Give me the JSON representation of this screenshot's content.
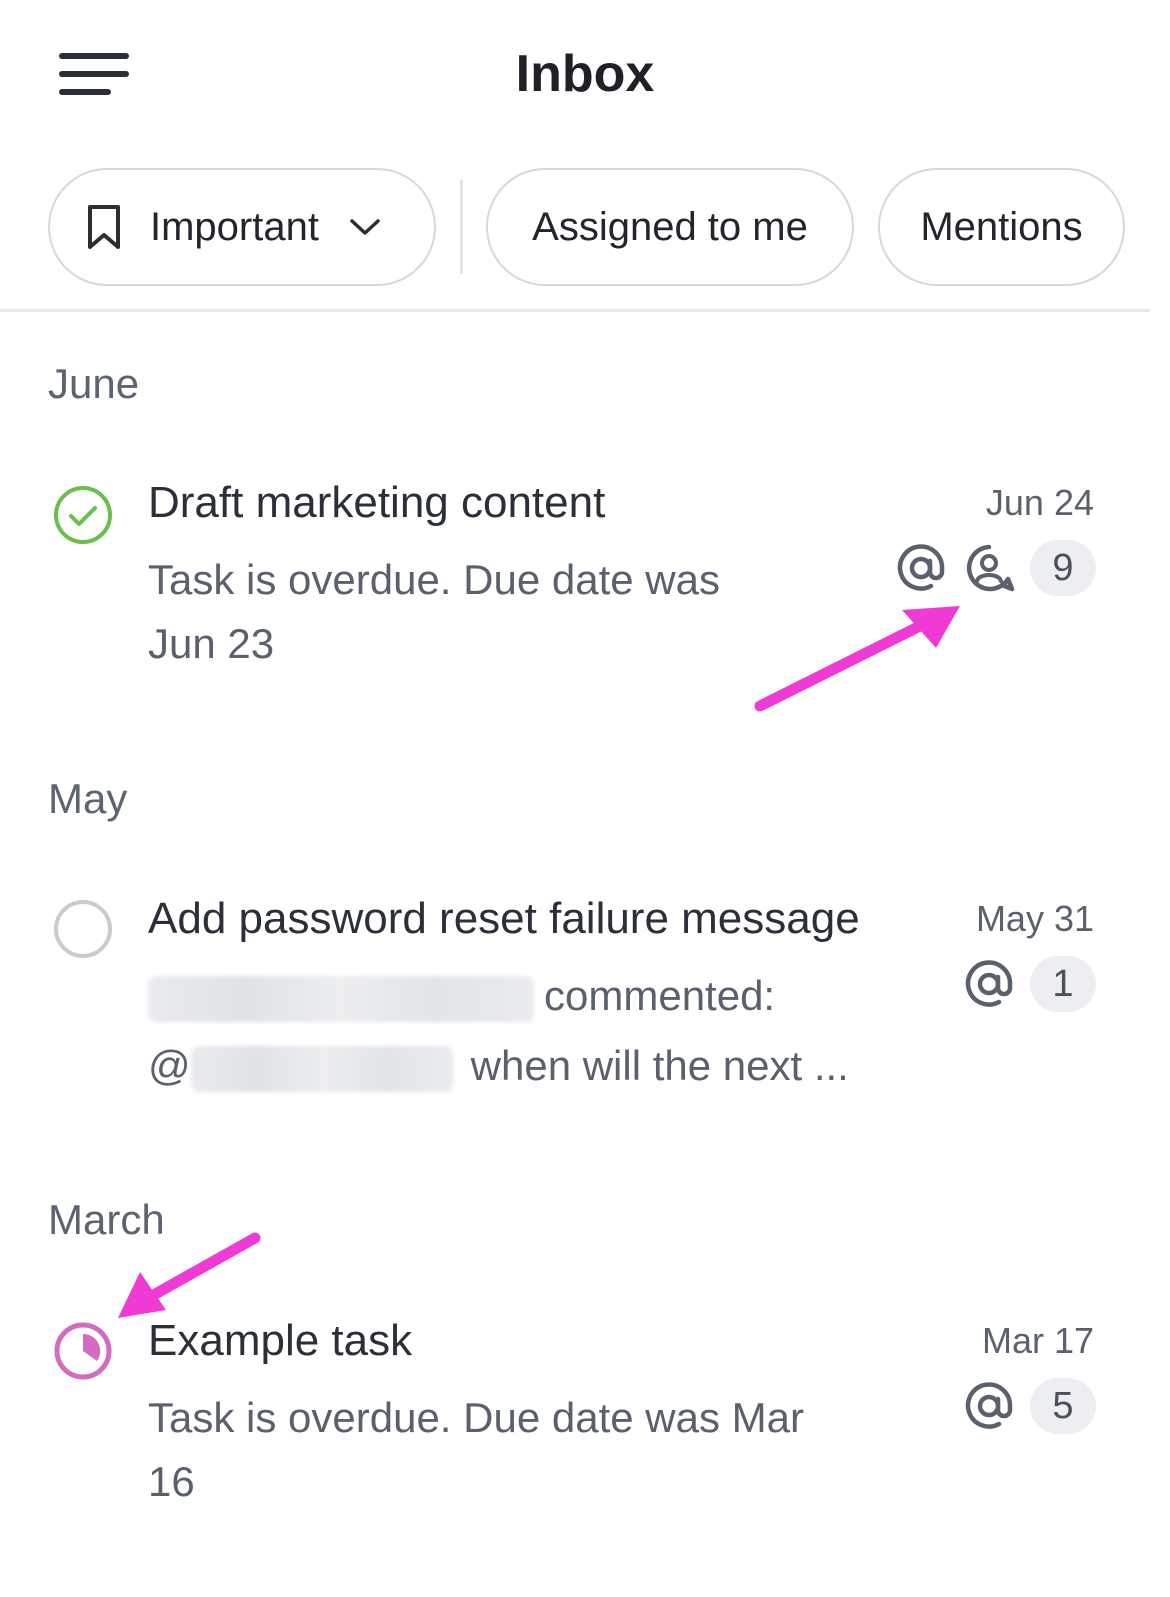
{
  "header": {
    "title": "Inbox",
    "menu_icon": "hamburger-menu-icon"
  },
  "filters": {
    "important": {
      "label": "Important",
      "icon": "bookmark-icon",
      "dropdown_icon": "chevron-down-icon"
    },
    "assigned": {
      "label": "Assigned to me"
    },
    "mentions": {
      "label": "Mentions"
    }
  },
  "sections": [
    {
      "label": "June",
      "items": [
        {
          "status": "completed",
          "status_icon": "check-circle-icon",
          "status_color": "#6abf4b",
          "title": "Draft marketing content",
          "subtitle_line1": "Task is overdue. Due date was",
          "subtitle_line2": "Jun 23",
          "date": "Jun 24",
          "icons": [
            "at-mention-icon",
            "assignee-icon"
          ],
          "count": "9"
        }
      ]
    },
    {
      "label": "May",
      "items": [
        {
          "status": "incomplete",
          "status_icon": "empty-circle-icon",
          "status_color": "#c9cbcf",
          "title": "Add password reset failure message",
          "subtitle_line1": "commented:",
          "subtitle_line2_prefix": "@",
          "subtitle_line2": "when will the next ...",
          "date": "May 31",
          "icons": [
            "at-mention-icon"
          ],
          "count": "1"
        }
      ]
    },
    {
      "label": "March",
      "items": [
        {
          "status": "in-progress",
          "status_icon": "progress-circle-icon",
          "status_color": "#d36bc0",
          "title": "Example task",
          "subtitle_line1": "Task is overdue. Due date was Mar",
          "subtitle_line2": "16",
          "date": "Mar 17",
          "icons": [
            "at-mention-icon"
          ],
          "count": "5"
        }
      ]
    }
  ],
  "colors": {
    "annotation_arrow": "#f03ad6",
    "chip_border": "#d6d8dc",
    "muted_text": "#5a616c"
  }
}
